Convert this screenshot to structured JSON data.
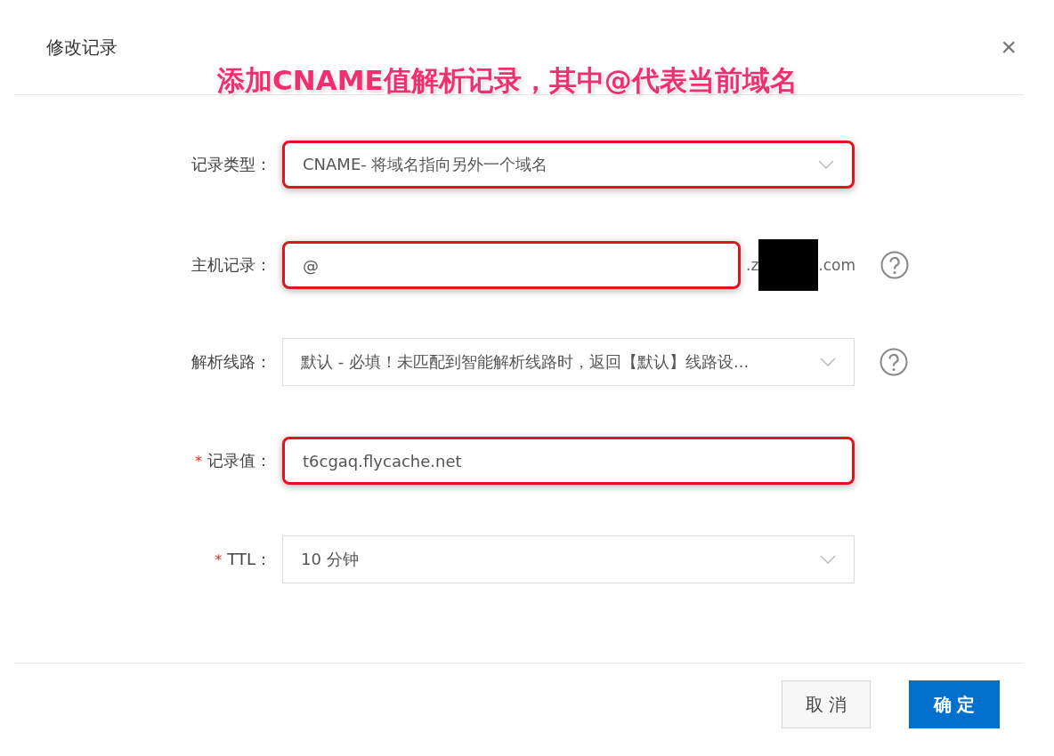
{
  "dialog": {
    "title": "修改记录",
    "close": "×"
  },
  "annotation": "添加CNAME值解析记录，其中@代表当前域名",
  "fields": [
    {
      "label": "记录类型：",
      "kind": "select",
      "value": "CNAME- 将域名指向另外一个域名",
      "required": false,
      "highlighted": true,
      "help": false
    },
    {
      "label": "主机记录：",
      "kind": "input",
      "value": "@",
      "required": false,
      "highlighted": true,
      "help": true,
      "suffix_start": ".z",
      "suffix_end": ".com",
      "redacted": true
    },
    {
      "label": "解析线路：",
      "kind": "select",
      "value": "默认 - 必填！未匹配到智能解析线路时，返回【默认】线路设...",
      "required": false,
      "highlighted": false,
      "help": true
    },
    {
      "label": "记录值：",
      "kind": "input",
      "value": "t6cgaq.flycache.net",
      "required": true,
      "required_mark": "*",
      "highlighted": true,
      "help": false
    },
    {
      "label": "TTL：",
      "kind": "select",
      "value": "10 分钟",
      "required": true,
      "required_mark": "*",
      "highlighted": false,
      "help": false
    }
  ],
  "buttons": [
    {
      "label": "取 消",
      "kind": "secondary"
    },
    {
      "label": "确 定",
      "kind": "primary"
    }
  ]
}
